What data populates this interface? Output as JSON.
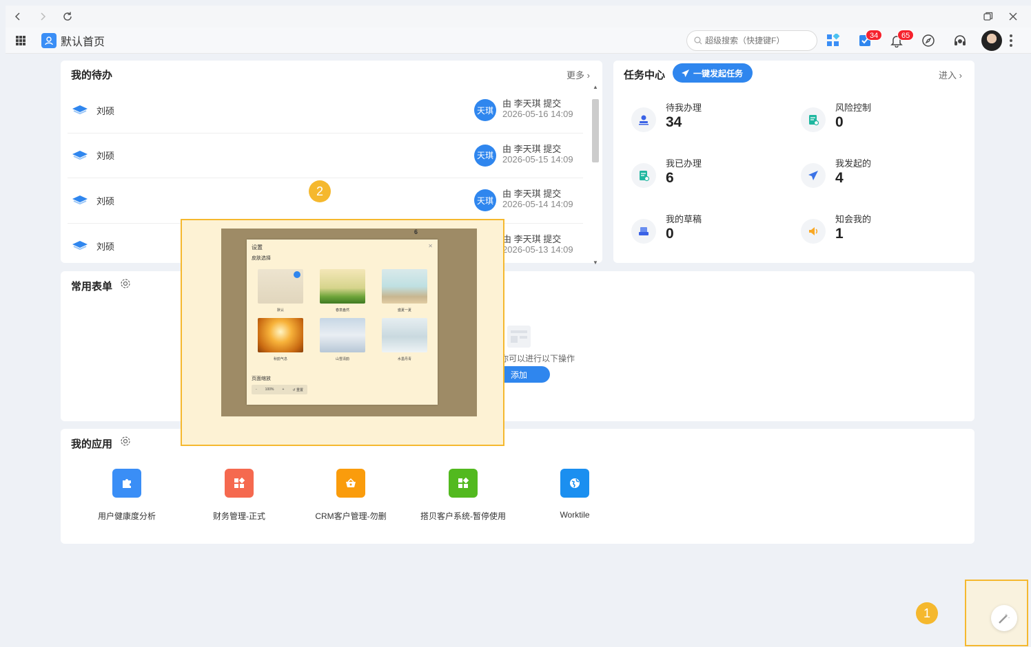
{
  "header": {
    "page_title": "默认首页",
    "search_placeholder": "超级搜索（快捷键F）",
    "task_badge": "34",
    "notice_badge": "65"
  },
  "todo": {
    "title": "我的待办",
    "more": "更多",
    "items": [
      {
        "name": "刘硕",
        "avatar": "天琪",
        "submit": "由 李天琪 提交",
        "time": "2026-05-16 14:09"
      },
      {
        "name": "刘硕",
        "avatar": "天琪",
        "submit": "由 李天琪 提交",
        "time": "2026-05-15 14:09"
      },
      {
        "name": "刘硕",
        "avatar": "天琪",
        "submit": "由 李天琪 提交",
        "time": "2026-05-14 14:09"
      },
      {
        "name": "刘硕",
        "avatar": "天琪",
        "submit": "由 李天琪 提交",
        "time": "2026-05-13 14:09"
      }
    ]
  },
  "task_center": {
    "title": "任务中心",
    "launch": "一键发起任务",
    "enter": "进入",
    "items": [
      {
        "label": "待我办理",
        "count": "34"
      },
      {
        "label": "风险控制",
        "count": "0"
      },
      {
        "label": "我已办理",
        "count": "6"
      },
      {
        "label": "我发起的",
        "count": "4"
      },
      {
        "label": "我的草稿",
        "count": "0"
      },
      {
        "label": "知会我的",
        "count": "1"
      }
    ]
  },
  "forms": {
    "title": "常用表单",
    "empty_text": "无表单，你可以进行以下操作",
    "add": "添加"
  },
  "apps": {
    "title": "我的应用",
    "items": [
      {
        "label": "用户健康度分析",
        "color": "#3a8ef6"
      },
      {
        "label": "财务管理-正式",
        "color": "#f5694f"
      },
      {
        "label": "CRM客户管理-勿删",
        "color": "#fa9c0c"
      },
      {
        "label": "搭贝客户系统-暂停使用",
        "color": "#52b91f"
      },
      {
        "label": "Worktile",
        "color": "#1b8ff0"
      }
    ]
  },
  "markers": {
    "one": "1",
    "two": "2"
  },
  "preview": {
    "dialog_title": "设置",
    "skin_section": "皮肤选择",
    "skins": [
      "默认",
      "春意盎然",
      "盛夏一夏",
      "秋韵气息",
      "山雪清韵",
      "水墨丹青"
    ],
    "zoom_section": "页面缩放",
    "zoom_minus": "-",
    "zoom_value": "100%",
    "zoom_plus": "+",
    "zoom_reset": "↺ 重置",
    "bg_count": "6"
  }
}
